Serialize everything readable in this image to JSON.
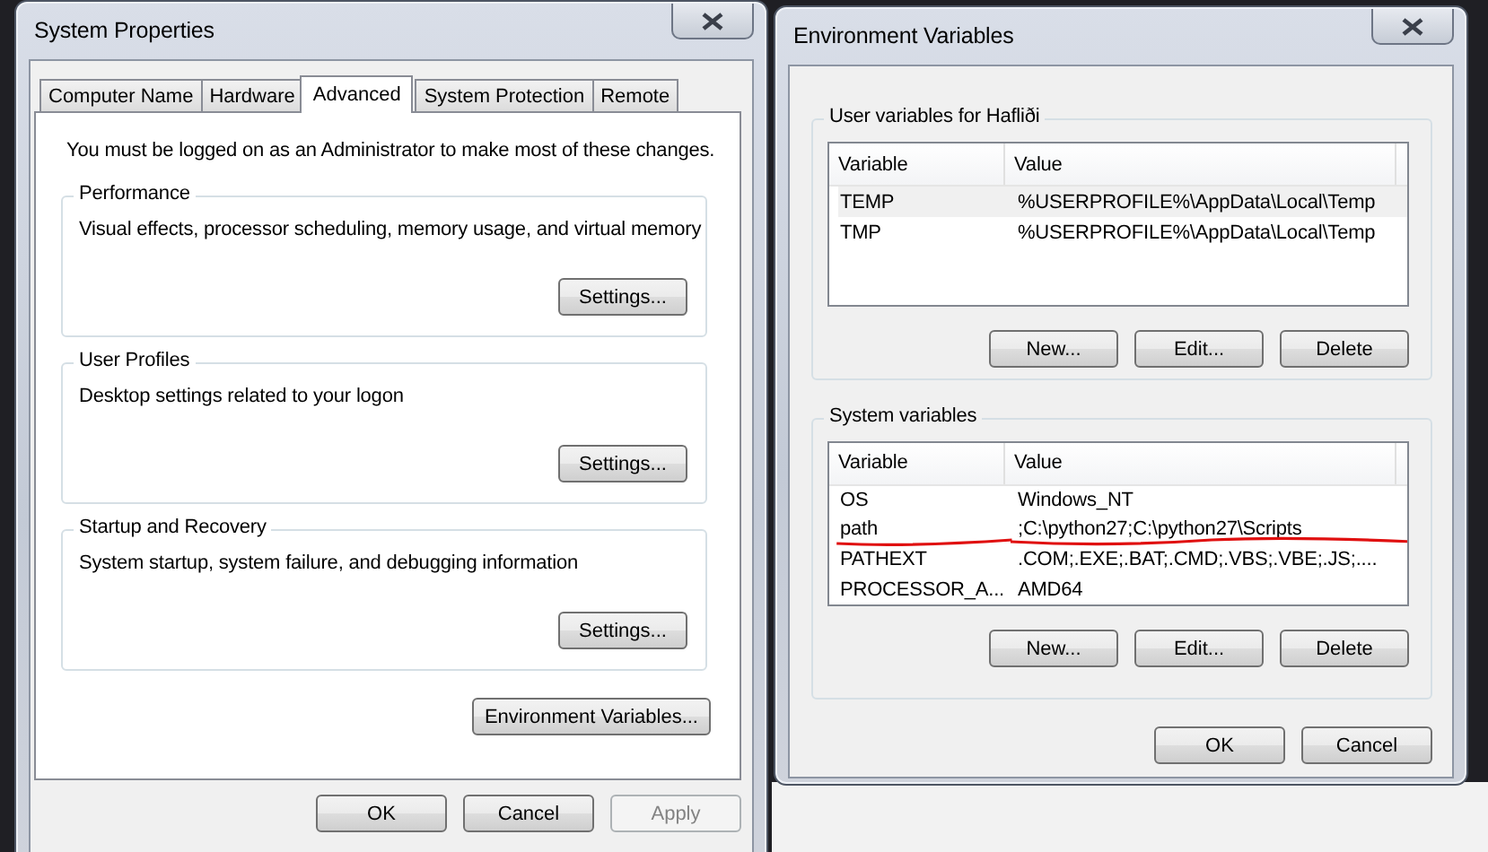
{
  "system_properties": {
    "title": "System Properties",
    "tabs": [
      {
        "label": "Computer Name",
        "selected": false
      },
      {
        "label": "Hardware",
        "selected": false
      },
      {
        "label": "Advanced",
        "selected": true
      },
      {
        "label": "System Protection",
        "selected": false
      },
      {
        "label": "Remote",
        "selected": false
      }
    ],
    "notice": "You must be logged on as an Administrator to make most of these changes.",
    "groups": [
      {
        "title": "Performance",
        "description": "Visual effects, processor scheduling, memory usage, and virtual memory",
        "button": "Settings..."
      },
      {
        "title": "User Profiles",
        "description": "Desktop settings related to your logon",
        "button": "Settings..."
      },
      {
        "title": "Startup and Recovery",
        "description": "System startup, system failure, and debugging information",
        "button": "Settings..."
      }
    ],
    "env_button": "Environment Variables...",
    "buttons": [
      {
        "label": "OK",
        "disabled": false
      },
      {
        "label": "Cancel",
        "disabled": false
      },
      {
        "label": "Apply",
        "disabled": true
      }
    ]
  },
  "environment_variables": {
    "title": "Environment Variables",
    "user_variables": {
      "title": "User variables for Hafliði",
      "columns": [
        "Variable",
        "Value"
      ],
      "rows": [
        {
          "name": "TEMP",
          "value": "%USERPROFILE%\\AppData\\Local\\Temp",
          "selected": true,
          "marked": false
        },
        {
          "name": "TMP",
          "value": "%USERPROFILE%\\AppData\\Local\\Temp",
          "selected": false,
          "marked": false
        }
      ],
      "buttons": [
        "New...",
        "Edit...",
        "Delete"
      ]
    },
    "system_variables": {
      "title": "System variables",
      "columns": [
        "Variable",
        "Value"
      ],
      "rows": [
        {
          "name": "OS",
          "value": "Windows_NT",
          "selected": false,
          "marked": false
        },
        {
          "name": "path",
          "value": ";C:\\python27;C:\\python27\\Scripts",
          "selected": false,
          "marked": true
        },
        {
          "name": "PATHEXT",
          "value": ".COM;.EXE;.BAT;.CMD;.VBS;.VBE;.JS;....",
          "selected": false,
          "marked": false
        },
        {
          "name": "PROCESSOR_A...",
          "value": "AMD64",
          "selected": false,
          "marked": false
        }
      ],
      "buttons": [
        "New...",
        "Edit...",
        "Delete"
      ]
    },
    "buttons": [
      "OK",
      "Cancel"
    ]
  }
}
